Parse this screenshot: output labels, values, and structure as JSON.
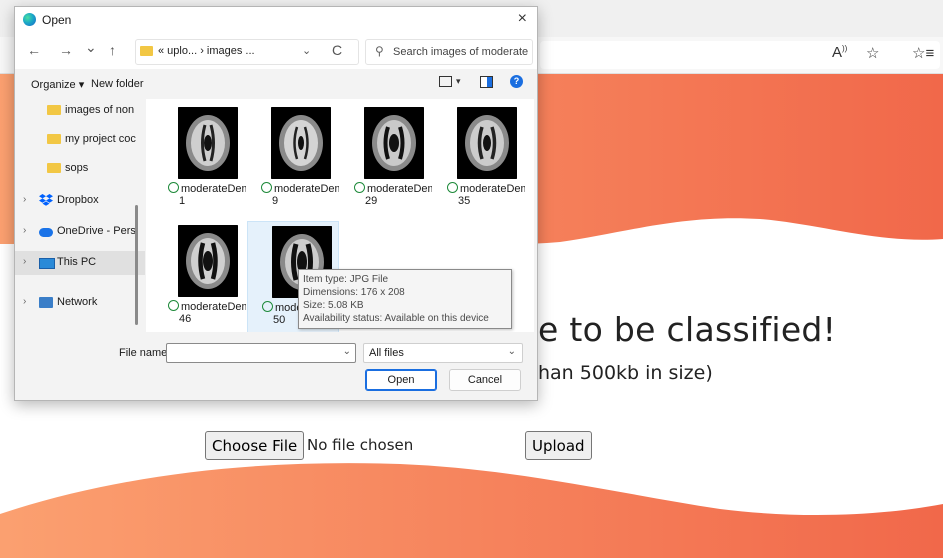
{
  "colors": {
    "wave_top_start": "#fba070",
    "wave_top_end": "#f1684a",
    "accent_blue": "#1a6ee0"
  },
  "browser": {
    "read_aloud_icon": "read-aloud-icon",
    "favorite_icon": "favorite-add-icon",
    "favorites_icon": "favorites-icon"
  },
  "page": {
    "title_fragment": "e to be classified!",
    "subtitle_fragment": "han 500kb in size)",
    "choose_file_label": "Choose File",
    "no_file_text": "No file chosen",
    "upload_label": "Upload"
  },
  "dialog": {
    "title": "Open",
    "close_glyph": "×",
    "nav": {
      "back": "←",
      "forward": "→",
      "recent": "⌄",
      "up": "↑",
      "path": "« uplo... › images ...",
      "path_dropdown": "⌄",
      "refresh": "C",
      "search_icon": "⚲",
      "search_placeholder": "Search images of moderate..."
    },
    "commands": {
      "organize": "Organize ▾",
      "new_folder": "New folder",
      "view_dropdown": "▾",
      "help": "?"
    },
    "sidebar": [
      {
        "label": "images of non",
        "icon": "folder",
        "chevron": ""
      },
      {
        "label": "my project coc",
        "icon": "folder",
        "chevron": ""
      },
      {
        "label": "sops",
        "icon": "folder",
        "chevron": ""
      },
      {
        "label": "Dropbox",
        "icon": "dropbox",
        "chevron": "›"
      },
      {
        "label": "OneDrive - Pers",
        "icon": "cloud",
        "chevron": "›"
      },
      {
        "label": "This PC",
        "icon": "pc",
        "chevron": "›"
      },
      {
        "label": "Network",
        "icon": "network",
        "chevron": "›"
      }
    ],
    "files": [
      {
        "name": "moderateDem",
        "num": "1"
      },
      {
        "name": "moderateDem",
        "num": "9"
      },
      {
        "name": "moderateDem",
        "num": "29"
      },
      {
        "name": "moderateDem",
        "num": "35"
      },
      {
        "name": "moderateDem",
        "num": "46"
      },
      {
        "name": "moderateDem",
        "num": "50"
      }
    ],
    "tooltip": {
      "item_type": "Item type: JPG File",
      "dimensions": "Dimensions: 176 x 208",
      "size": "Size: 5.08 KB",
      "availability": "Availability status: Available on this device"
    },
    "bottom": {
      "file_name_label": "File name:",
      "file_name_value": "",
      "file_type": "All files",
      "dropdown": "⌄",
      "open": "Open",
      "cancel": "Cancel"
    }
  }
}
